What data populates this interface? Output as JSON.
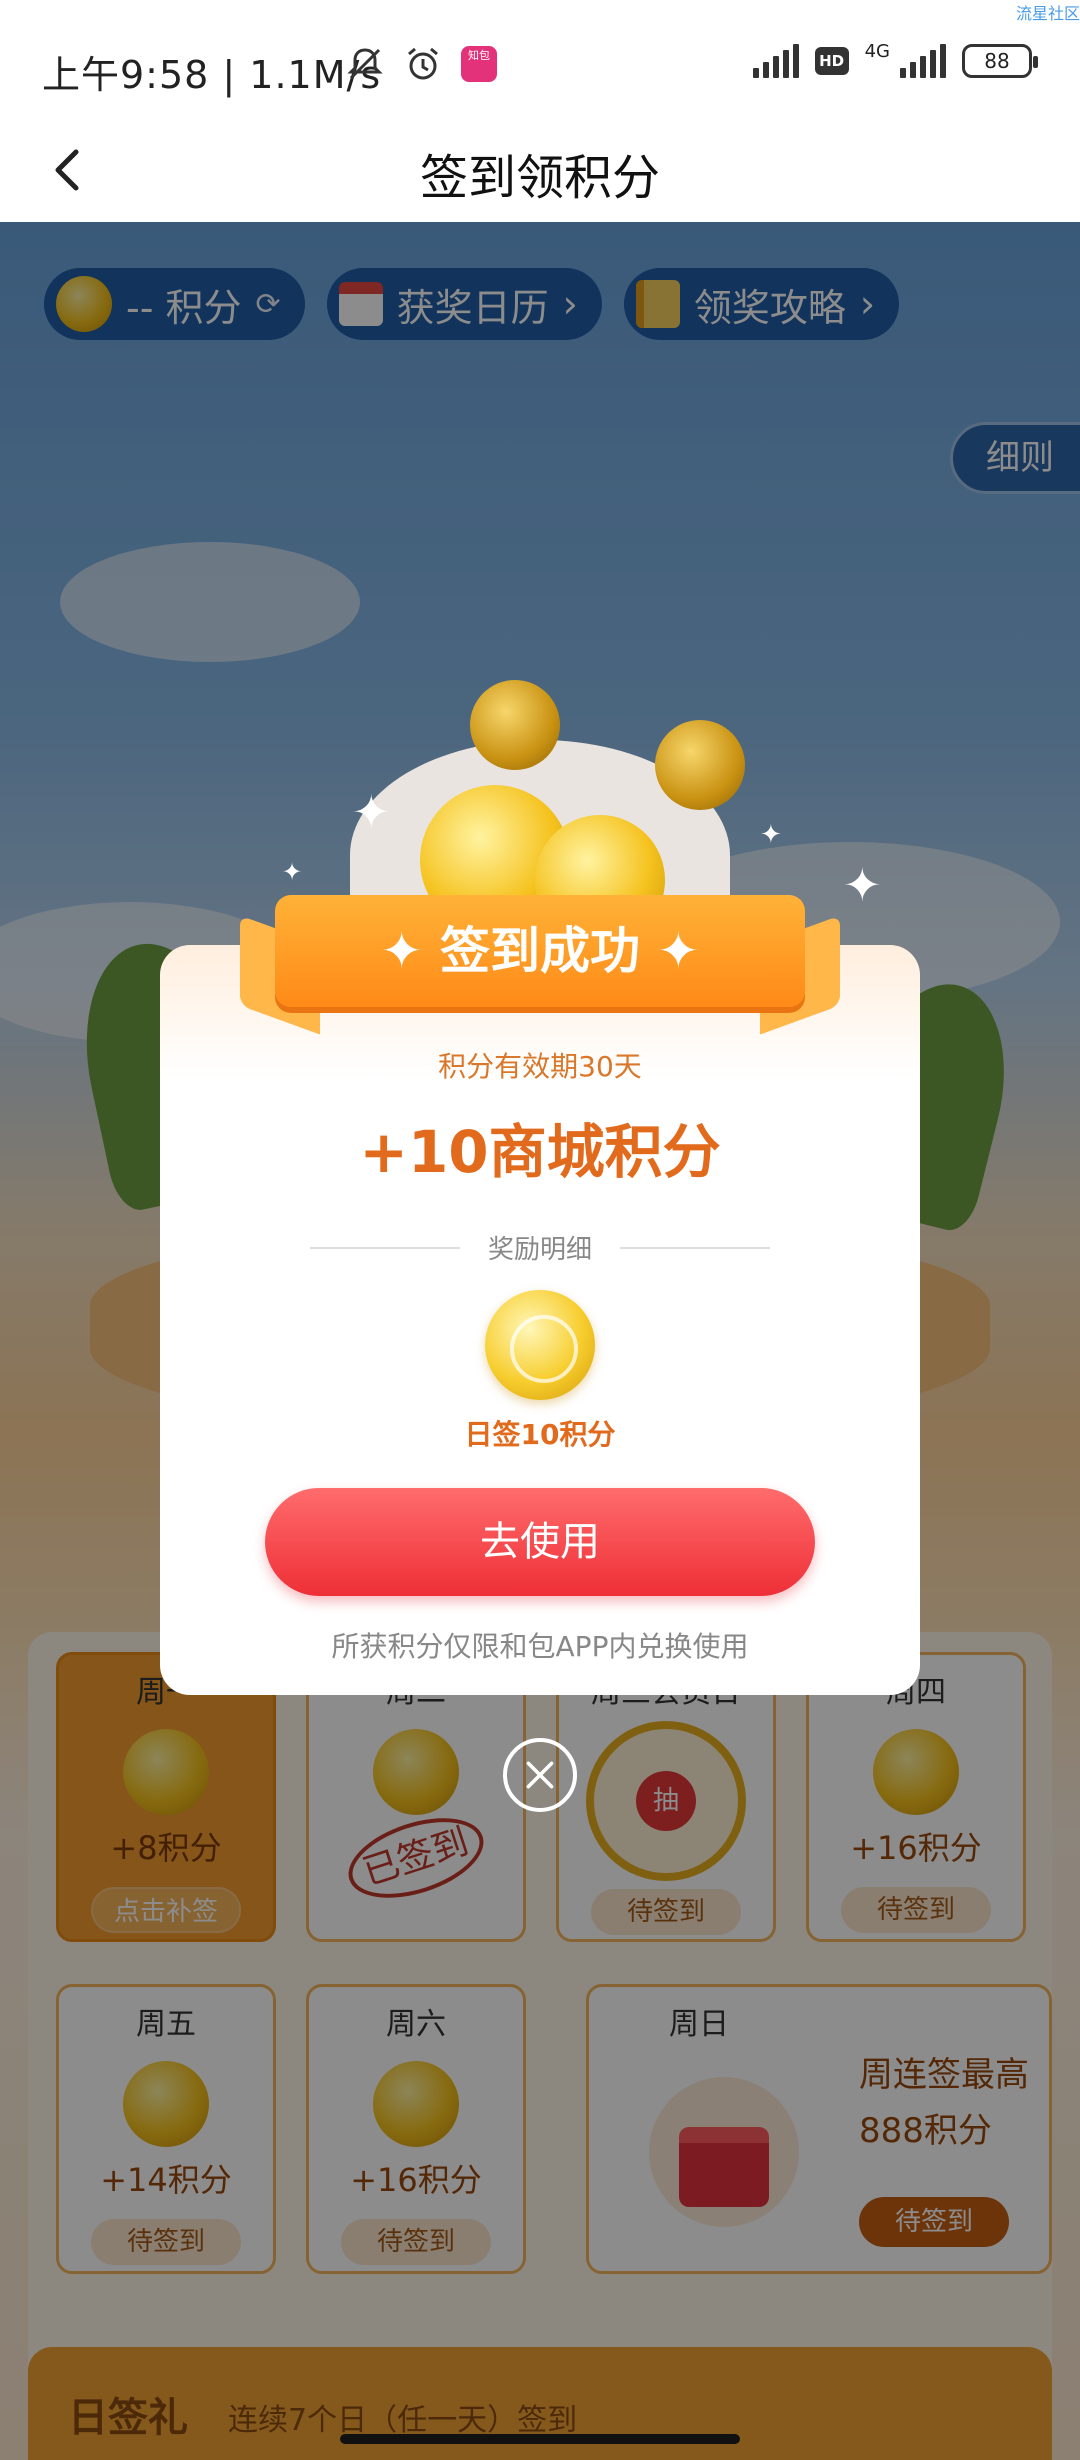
{
  "status_bar": {
    "watermark": "流星社区",
    "time_speed": "上午9:58 | 1.1M/s",
    "app_badge": "知包",
    "network": "4G",
    "battery": "88"
  },
  "nav": {
    "title": "签到领积分"
  },
  "chips": {
    "points": "-- 积分",
    "calendar": "获奖日历",
    "guide": "领奖攻略",
    "chevron": "›"
  },
  "rules_button": "细则",
  "modal": {
    "ribbon": "✦ 签到成功 ✦",
    "validity": "积分有效期30天",
    "amount": "+10商城积分",
    "details_heading": "奖励明细",
    "reward_label": "日签10积分",
    "use_button": "去使用",
    "note": "所获积分仅限和包APP内兑换使用"
  },
  "week": {
    "days": [
      {
        "label": "周一",
        "points": "+8积分",
        "action": "点击补签"
      },
      {
        "label": "周二",
        "points": "",
        "action": "已签到"
      },
      {
        "label": "周三会员日",
        "points": "抽",
        "action": "待签到"
      },
      {
        "label": "周四",
        "points": "+16积分",
        "action": "待签到"
      },
      {
        "label": "周五",
        "points": "+14积分",
        "action": "待签到"
      },
      {
        "label": "周六",
        "points": "+16积分",
        "action": "待签到"
      }
    ],
    "sunday": {
      "label": "周日",
      "line1": "周连签最高",
      "line2": "888积分",
      "action": "待签到"
    }
  },
  "bottom": {
    "title": "日签礼",
    "subtitle": "连续7个日（任一天）签到"
  },
  "colors": {
    "accent_orange": "#ff8a17",
    "button_red": "#ee2f37",
    "chip_blue": "#1f5ea8"
  }
}
